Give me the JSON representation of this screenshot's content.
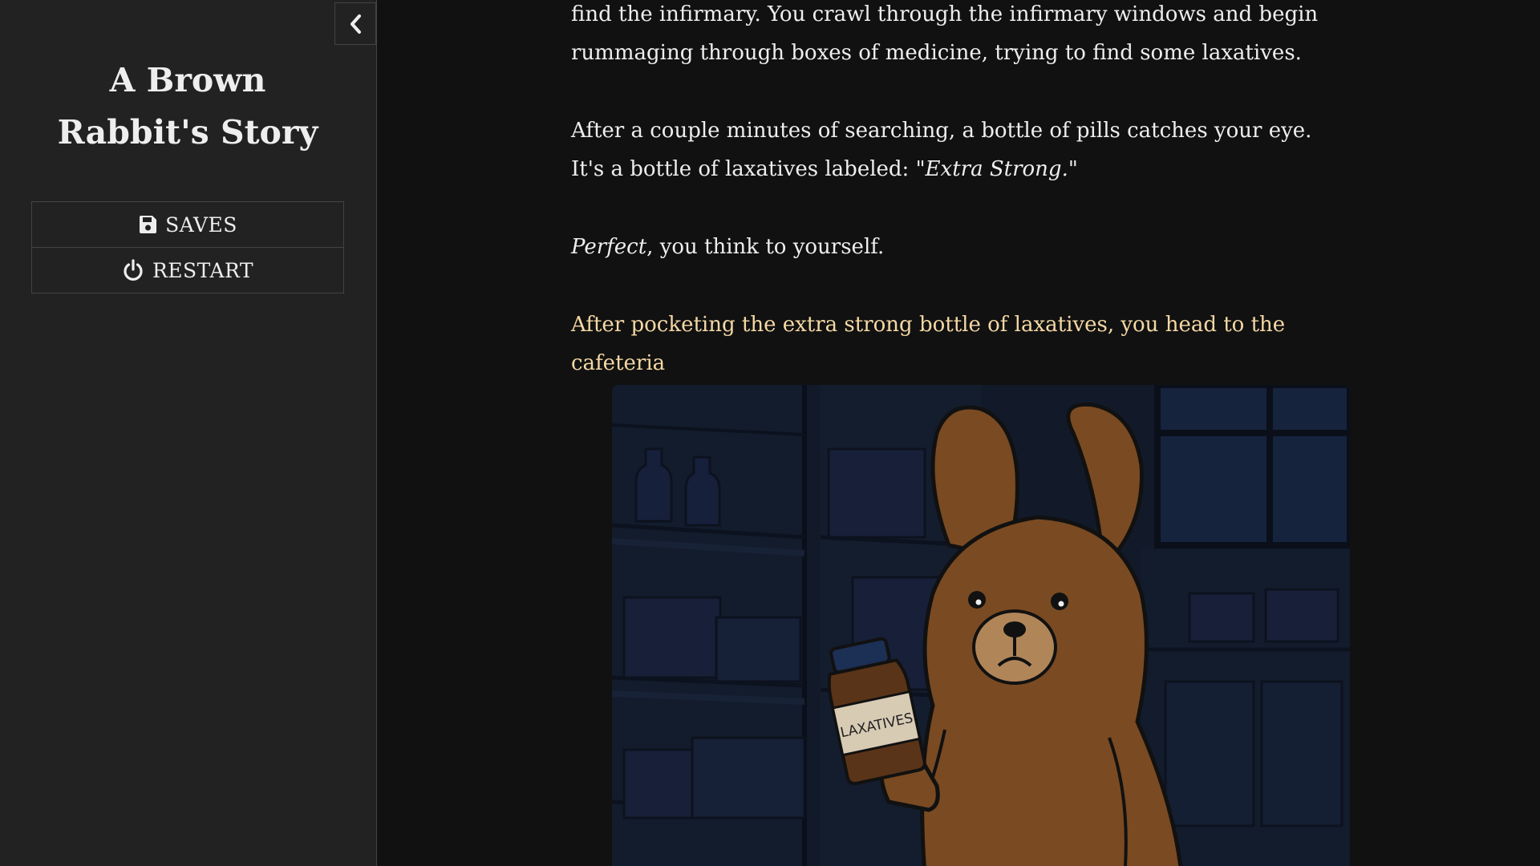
{
  "sidebar": {
    "title": "A Brown Rabbit's Story",
    "saves_label": "SAVES",
    "restart_label": "RESTART"
  },
  "passage": {
    "p1": "find the infirmary. You crawl through the infirmary windows and begin rummaging through boxes of medicine, trying to find some laxatives.",
    "p2_text": "After a couple minutes of searching, a bottle of pills catches your eye. It's a bottle of laxatives labeled: ",
    "p2_quote": "\"Extra Strong.\"",
    "p3_em": "Perfect",
    "p3_text": ", you think to yourself.",
    "link": "After pocketing the extra strong bottle of laxatives, you head to the cafeteria"
  },
  "image": {
    "bottle_label": "LAXATIVES"
  },
  "colors": {
    "background": "#111111",
    "sidebar": "#222222",
    "border": "#444444",
    "text": "#eeeeee",
    "link": "#f5d8a4"
  }
}
